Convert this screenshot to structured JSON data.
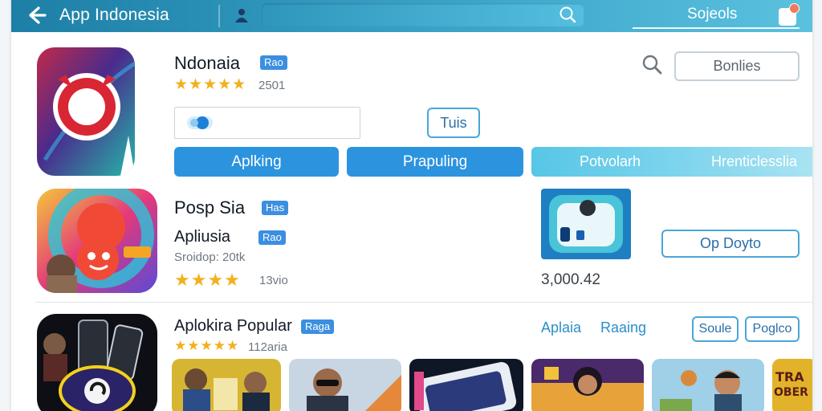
{
  "header": {
    "title": "App Indonesia",
    "right_label": "Sojeols"
  },
  "featured": {
    "name": "Ndonaia",
    "badge": "Rao",
    "rating_stars": 4.5,
    "rating_text": "2501",
    "action_button": "Bonlies",
    "tags_button": "Tuis",
    "tabs": [
      "Aplking",
      "Prapuling"
    ],
    "strip_tabs": [
      "Potvolarh",
      "Hrenticlesslia"
    ]
  },
  "second_app": {
    "name": "Posp Sia",
    "badge": "Has",
    "subtitle": "Apliusia",
    "subtitle_badge": "Rao",
    "meta": "Sroidop: 20tk",
    "rating_stars": 4,
    "rating_text": "13vio",
    "price": "3,000.42",
    "open_button": "Op Doyto"
  },
  "popular": {
    "title": "Aplokira Popular",
    "badge": "Raga",
    "rating_stars": 5,
    "rating_text": "112aria",
    "link_1": "Aplaia",
    "link_2": "Raaing",
    "button_1": "Soule",
    "button_2": "Poglco",
    "thumb_text": "TRA OBER"
  },
  "colors": {
    "primary": "#2c93df",
    "accent_light": "#5bc6e6",
    "star": "#f2b01e",
    "header_start": "#1d7fa6",
    "header_end": "#5bc1df"
  }
}
